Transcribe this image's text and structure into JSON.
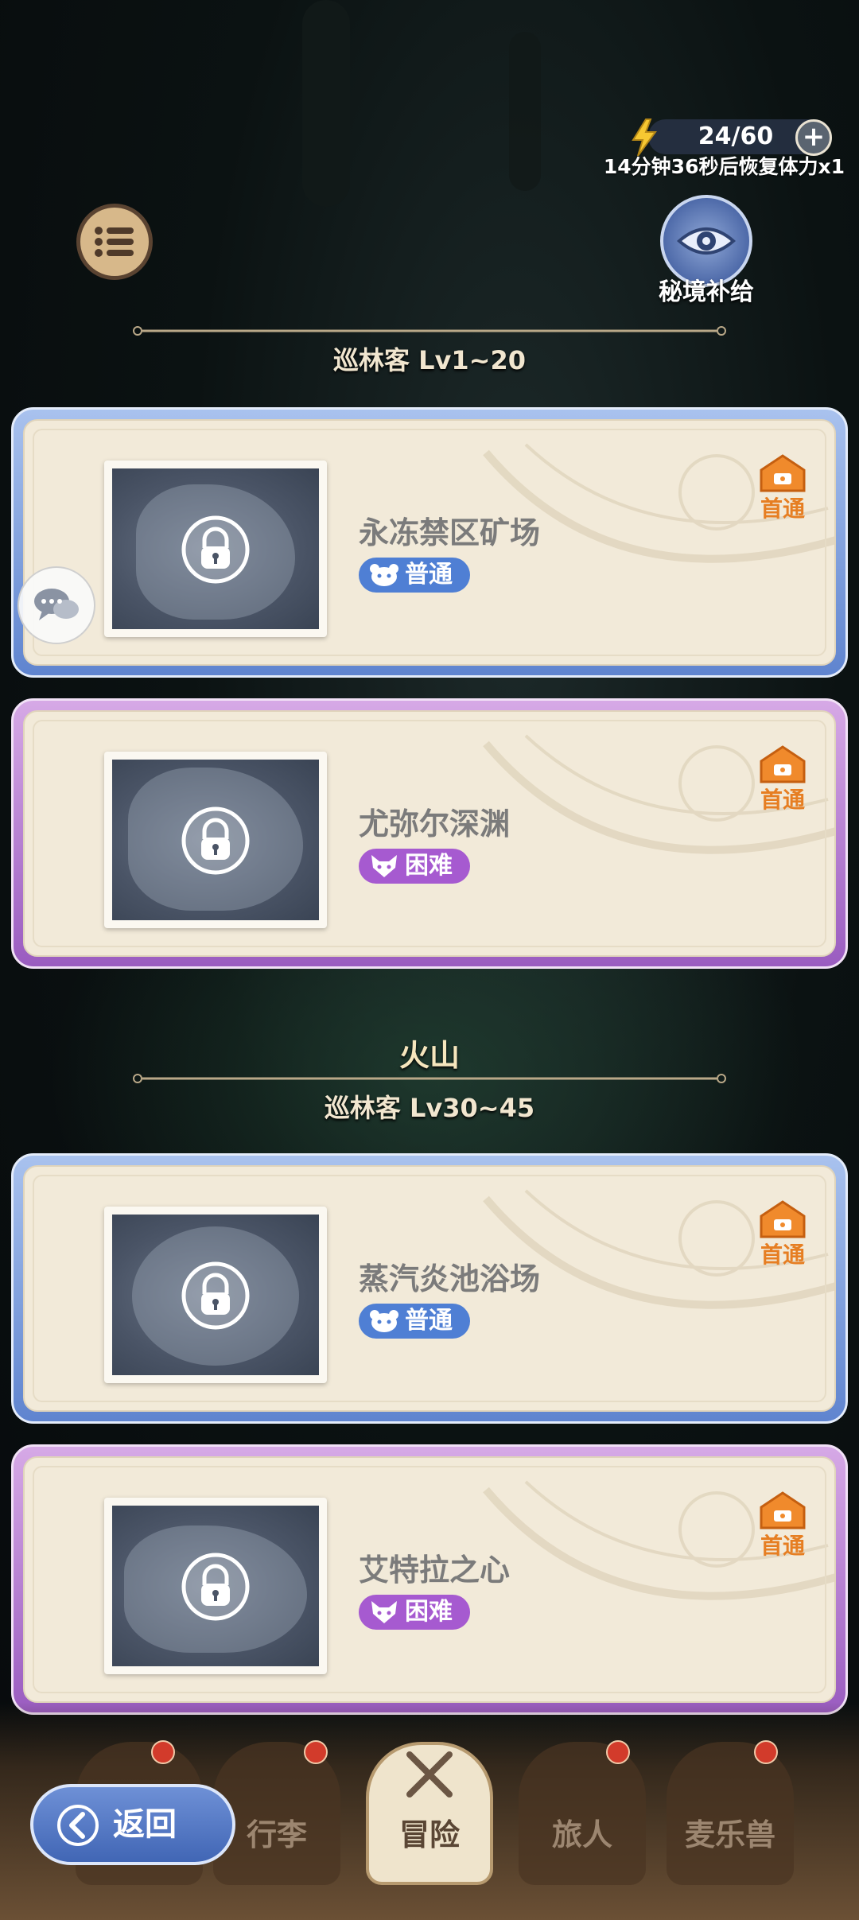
{
  "stamina": {
    "value": "24/60",
    "recover_text": "14分钟36秒后恢复体力x1"
  },
  "top": {
    "supply_label": "秘境补给"
  },
  "sections": [
    {
      "level_label": "巡林客 Lv1~20"
    },
    {
      "region": "火山",
      "level_label": "巡林客 Lv30~45"
    }
  ],
  "dungeons": [
    {
      "name": "永冻禁区矿场",
      "difficulty": "普通",
      "first_clear": "首通",
      "theme": "blue"
    },
    {
      "name": "尤弥尔深渊",
      "difficulty": "困难",
      "first_clear": "首通",
      "theme": "purple"
    },
    {
      "name": "蒸汽炎池浴场",
      "difficulty": "普通",
      "first_clear": "首通",
      "theme": "blue"
    },
    {
      "name": "艾特拉之心",
      "difficulty": "困难",
      "first_clear": "首通",
      "theme": "purple"
    }
  ],
  "nav": {
    "back": "返回",
    "tabs": [
      {
        "label": "行李"
      },
      {
        "label": "冒险"
      },
      {
        "label": "旅人"
      },
      {
        "label": "麦乐兽"
      }
    ]
  },
  "colors": {
    "normal_badge": "#4f7fd4",
    "hard_badge": "#a65ad0",
    "first_clear": "#e67e22",
    "card_bg": "#f2ead9"
  }
}
